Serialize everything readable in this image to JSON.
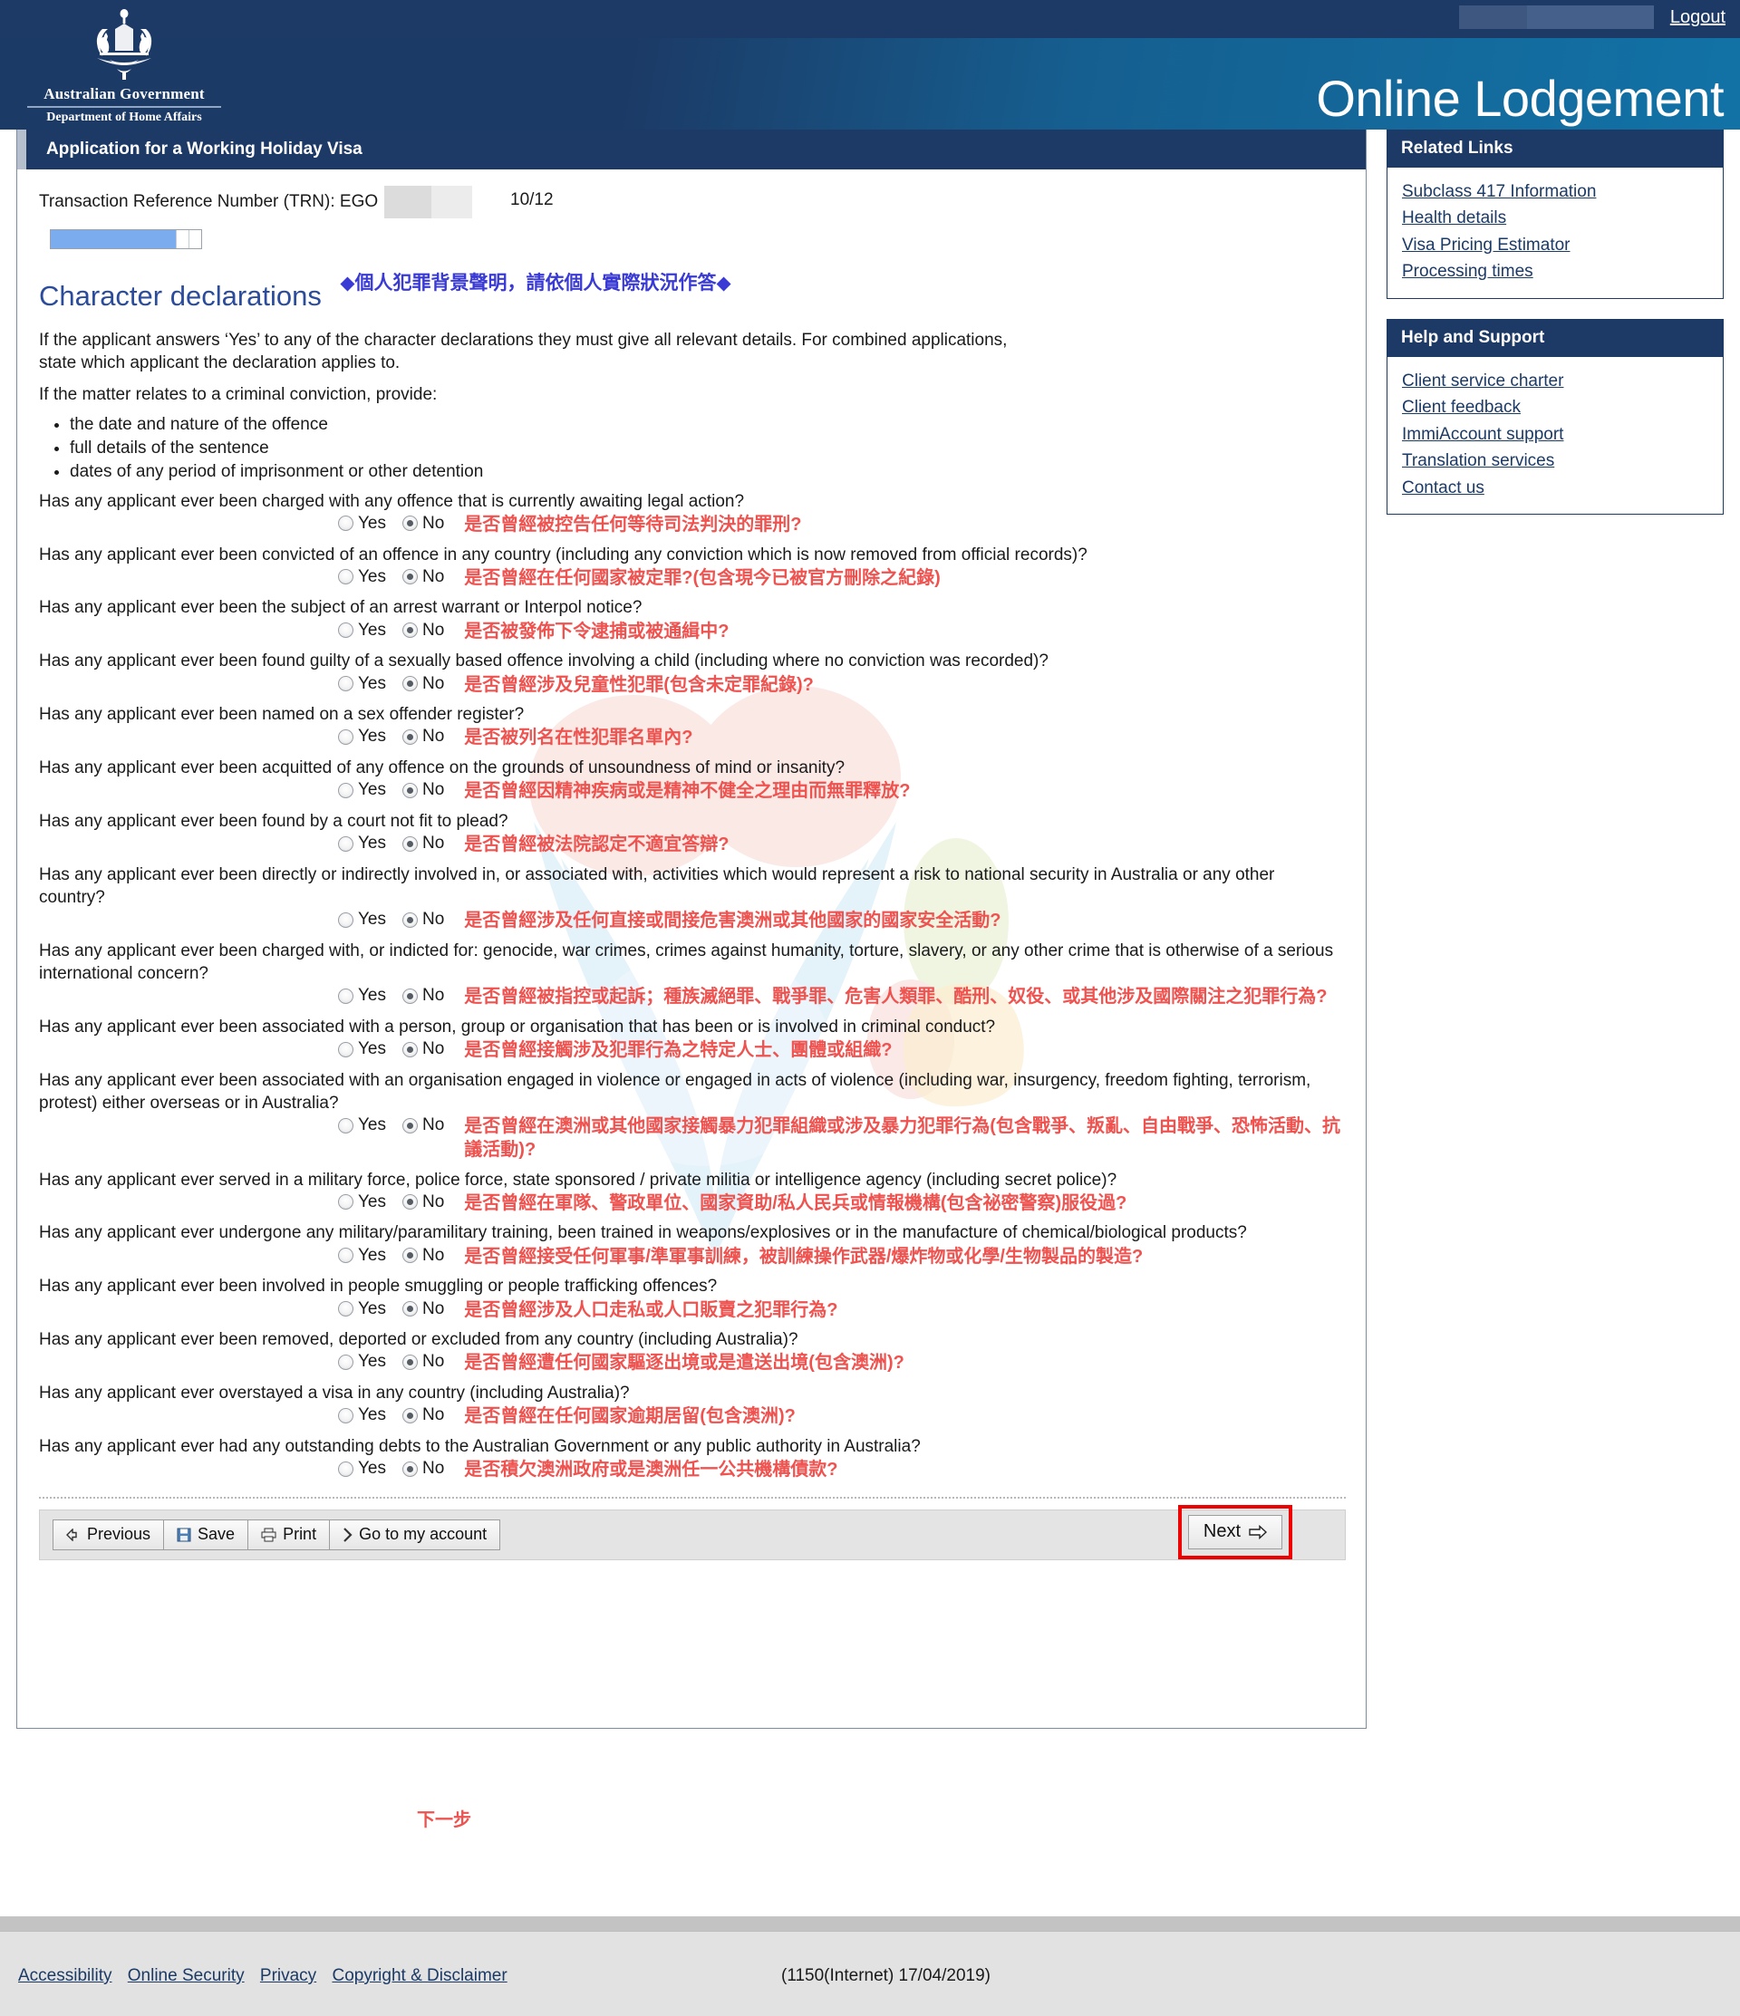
{
  "topbar": {
    "logout_label": "Logout"
  },
  "masthead": {
    "crest_line1": "Australian Government",
    "crest_line2": "Department of Home Affairs",
    "site_title": "Online Lodgement"
  },
  "card": {
    "title": "Application for a Working Holiday Visa",
    "trn_label": "Transaction Reference Number (TRN): EGO",
    "page_counter": "10/12",
    "progress_percent": 83
  },
  "section": {
    "heading": "Character declarations",
    "heading_cn": "◆個人犯罪背景聲明，請依個人實際狀況作答◆",
    "intro1": "If the applicant answers ‘Yes’ to any of the character declarations they must give all relevant details. For combined applications, state which applicant the declaration applies to.",
    "intro2": "If the matter relates to a criminal conviction, provide:",
    "bullets": [
      "the date and nature of the offence",
      "full details of the sentence",
      "dates of any period of imprisonment or other detention"
    ]
  },
  "answers": {
    "yes_label": "Yes",
    "no_label": "No",
    "selected": "No"
  },
  "questions": [
    {
      "text": "Has any applicant ever been charged with any offence that is currently awaiting legal action?",
      "cn": "是否曾經被控告任何等待司法判決的罪刑?"
    },
    {
      "text": "Has any applicant ever been convicted of an offence in any country (including any conviction which is now removed from official records)?",
      "cn": "是否曾經在任何國家被定罪?(包含現今已被官方刪除之紀錄)"
    },
    {
      "text": "Has any applicant ever been the subject of an arrest warrant or Interpol notice?",
      "cn": "是否被發佈下令逮捕或被通緝中?"
    },
    {
      "text": "Has any applicant ever been found guilty of a sexually based offence involving a child (including where no conviction was recorded)?",
      "cn": "是否曾經涉及兒童性犯罪(包含未定罪紀錄)?"
    },
    {
      "text": "Has any applicant ever been named on a sex offender register?",
      "cn": "是否被列名在性犯罪名單內?"
    },
    {
      "text": "Has any applicant ever been acquitted of any offence on the grounds of unsoundness of mind or insanity?",
      "cn": "是否曾經因精神疾病或是精神不健全之理由而無罪釋放?"
    },
    {
      "text": "Has any applicant ever been found by a court not fit to plead?",
      "cn": "是否曾經被法院認定不適宜答辯?"
    },
    {
      "text": "Has any applicant ever been directly or indirectly involved in, or associated with, activities which would represent a risk to national security in Australia or any other country?",
      "cn": "是否曾經涉及任何直接或間接危害澳洲或其他國家的國家安全活動?"
    },
    {
      "text": "Has any applicant ever been charged with, or indicted for: genocide, war crimes, crimes against humanity, torture, slavery, or any other crime that is otherwise of a serious international concern?",
      "cn": "是否曾經被指控或起訴；種族滅絕罪、戰爭罪、危害人類罪、酷刑、奴役、或其他涉及國際關注之犯罪行為?"
    },
    {
      "text": "Has any applicant ever been associated with a person, group or organisation that has been or is involved in criminal conduct?",
      "cn": "是否曾經接觸涉及犯罪行為之特定人士、團體或組織?"
    },
    {
      "text": "Has any applicant ever been associated with an organisation engaged in violence or engaged in acts of violence (including war, insurgency, freedom fighting, terrorism, protest) either overseas or in Australia?",
      "cn": "是否曾經在澳洲或其他國家接觸暴力犯罪組織或涉及暴力犯罪行為(包含戰爭、叛亂、自由戰爭、恐怖活動、抗議活動)?"
    },
    {
      "text": "Has any applicant ever served in a military force, police force, state sponsored / private militia or intelligence agency (including secret police)?",
      "cn": "是否曾經在軍隊、警政單位、國家資助/私人民兵或情報機構(包含祕密警察)服役過?"
    },
    {
      "text": "Has any applicant ever undergone any military/paramilitary training, been trained in weapons/explosives or in the manufacture of chemical/biological products?",
      "cn": "是否曾經接受任何軍事/準軍事訓練，被訓練操作武器/爆炸物或化學/生物製品的製造?"
    },
    {
      "text": "Has any applicant ever been involved in people smuggling or people trafficking offences?",
      "cn": "是否曾經涉及人口走私或人口販賣之犯罪行為?"
    },
    {
      "text": "Has any applicant ever been removed, deported or excluded from any country (including Australia)?",
      "cn": "是否曾經遭任何國家驅逐出境或是遣送出境(包含澳洲)?"
    },
    {
      "text": "Has any applicant ever overstayed a visa in any country (including Australia)?",
      "cn": "是否曾經在任何國家逾期居留(包含澳洲)?"
    },
    {
      "text": "Has any applicant ever had any outstanding debts to the Australian Government or any public authority in Australia?",
      "cn": "是否積欠澳洲政府或是澳洲任一公共機構債款?"
    }
  ],
  "buttons": {
    "previous": "Previous",
    "save": "Save",
    "print": "Print",
    "account": "Go to my account",
    "next": "Next",
    "next_cn": "下一步"
  },
  "sidebar": {
    "panels": [
      {
        "title": "Related Links",
        "links": [
          "Subclass 417 Information",
          "Health details",
          "Visa Pricing Estimator",
          "Processing times"
        ]
      },
      {
        "title": "Help and Support",
        "links": [
          "Client service charter",
          "Client feedback",
          "ImmiAccount support",
          "Translation services",
          "Contact us"
        ]
      }
    ]
  },
  "footer": {
    "links": [
      "Accessibility",
      "Online Security",
      "Privacy",
      "Copyright & Disclaimer"
    ],
    "build": "(1150(Internet) 17/04/2019)"
  },
  "colors": {
    "navy": "#1d3a66",
    "teal": "#1272a6",
    "heading_blue": "#2b4c9b",
    "annotation_red": "#ef5350",
    "annotation_blue": "#3a3ad4",
    "highlight_red": "#ee0000",
    "progress_blue": "#7badee"
  }
}
